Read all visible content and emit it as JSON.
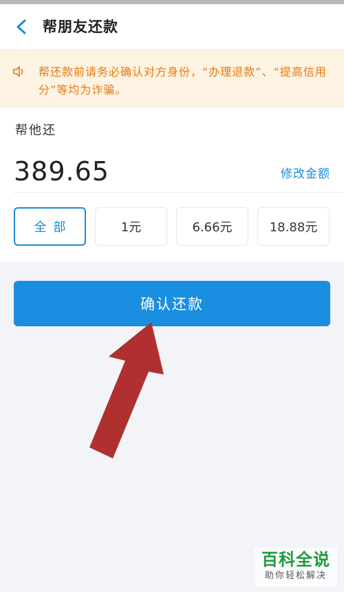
{
  "header": {
    "title": "帮朋友还款"
  },
  "notice": {
    "text": "帮还款前请务必确认对方身份，“办理退款”、“提高信用分”等均为诈骗。"
  },
  "repay": {
    "label": "帮他还",
    "amount": "389.65",
    "modify_label": "修改金额",
    "options": [
      "全部",
      "1元",
      "6.66元",
      "18.88元"
    ],
    "selected_option": "全部"
  },
  "confirm_label": "确认还款",
  "watermark": {
    "title": "百科全说",
    "subtitle": "助你轻松解决"
  },
  "colors": {
    "accent": "#1a8ee0",
    "notice_text": "#e8780f",
    "notice_bg": "#fdf3e2",
    "arrow": "#b03030"
  }
}
